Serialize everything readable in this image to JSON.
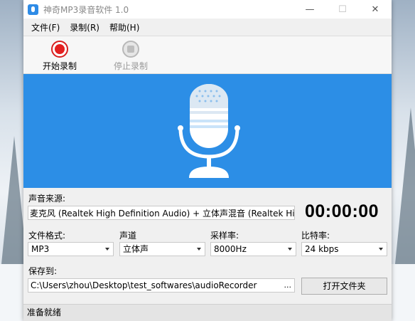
{
  "window": {
    "title": "神奇MP3录音软件 1.0",
    "min_glyph": "—",
    "max_glyph": "☐",
    "close_glyph": "✕"
  },
  "menu": [
    "文件(F)",
    "录制(R)",
    "帮助(H)"
  ],
  "toolbar": {
    "start_label": "开始录制",
    "stop_label": "停止录制"
  },
  "colors": {
    "banner": "#2c8ee6",
    "record_red": "#e32020",
    "mic_white": "#ffffff",
    "mic_light": "#dce8f3"
  },
  "source": {
    "label": "声音来源:",
    "value": "麦克风 (Realtek High Definition Audio) + 立体声混音 (Realtek Hig ..."
  },
  "timer": "00:00:00",
  "format": {
    "label": "文件格式:",
    "value": "MP3"
  },
  "channel": {
    "label": "声道",
    "value": "立体声"
  },
  "samplerate": {
    "label": "采样率:",
    "value": "8000Hz"
  },
  "bitrate": {
    "label": "比特率:",
    "value": "24 kbps"
  },
  "save": {
    "label": "保存到:",
    "path": "C:\\Users\\zhou\\Desktop\\test_softwares\\audioRecorder",
    "browse": "...",
    "open_folder": "打开文件夹"
  },
  "status": "准备就绪",
  "icons": {
    "app": "microphone-app-icon",
    "start": "record-icon",
    "stop": "stop-icon",
    "banner": "microphone-icon"
  }
}
